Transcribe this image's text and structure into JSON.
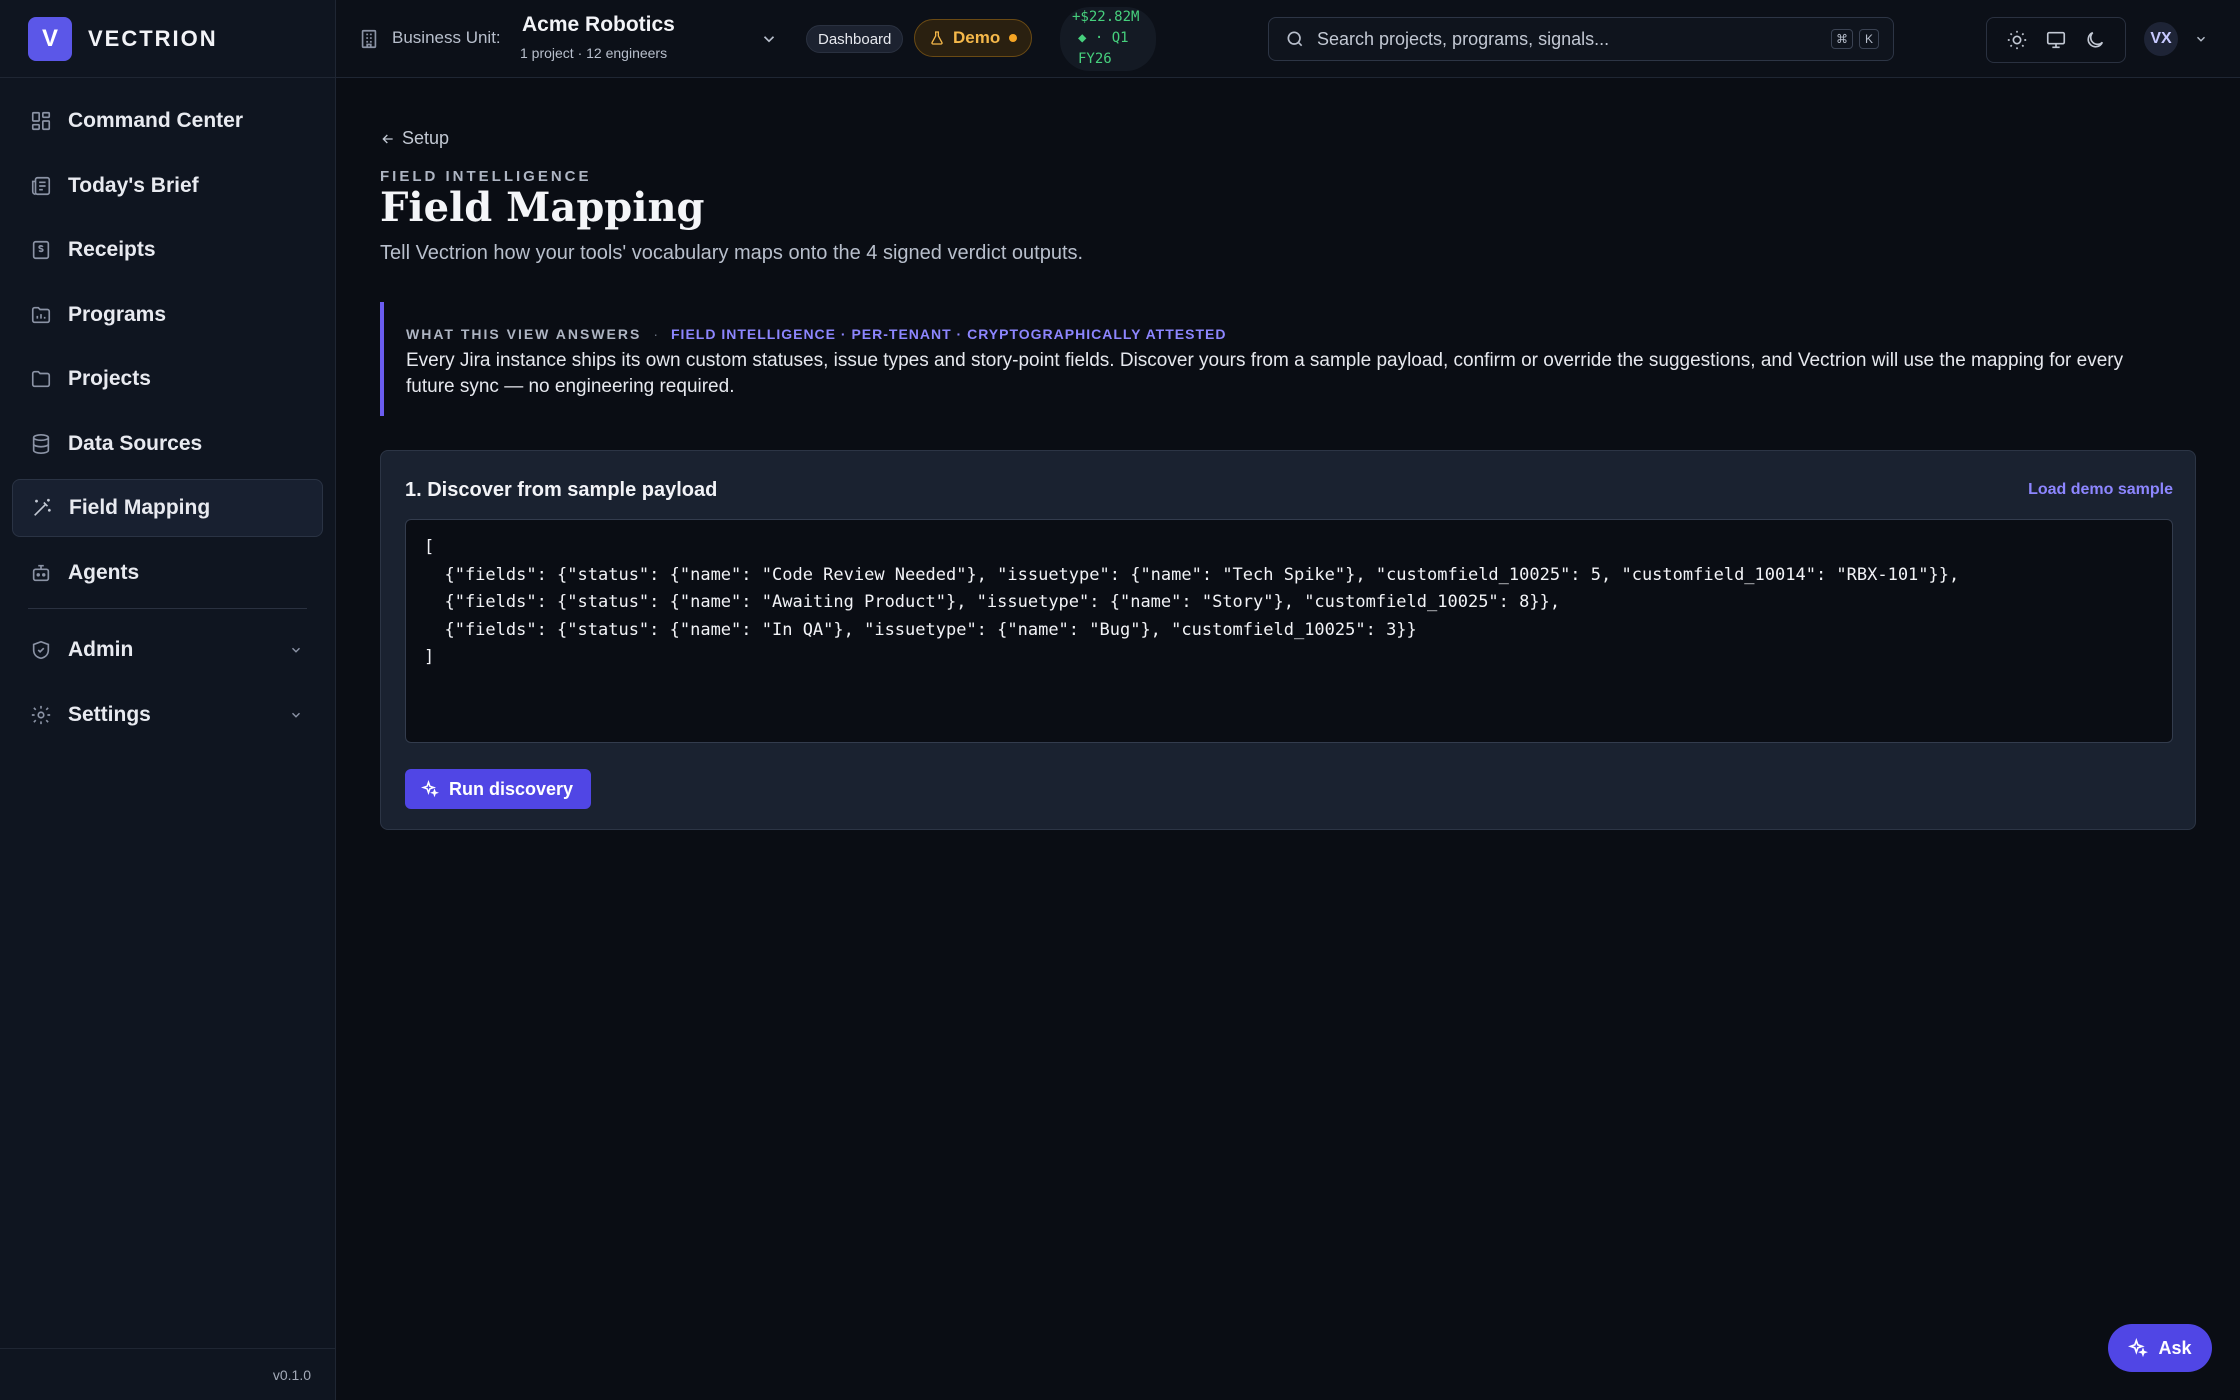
{
  "brand": {
    "logo_letter": "V",
    "name": "VECTRION"
  },
  "sidebar": {
    "items": [
      {
        "label": "Command Center",
        "icon": "grid-icon"
      },
      {
        "label": "Today's Brief",
        "icon": "newspaper-icon"
      },
      {
        "label": "Receipts",
        "icon": "receipt-icon"
      },
      {
        "label": "Programs",
        "icon": "chart-folder-icon"
      },
      {
        "label": "Projects",
        "icon": "folder-icon"
      },
      {
        "label": "Data Sources",
        "icon": "database-icon"
      },
      {
        "label": "Field Mapping",
        "icon": "wand-icon",
        "active": true
      },
      {
        "label": "Agents",
        "icon": "bot-icon"
      }
    ],
    "groups": [
      {
        "label": "Admin",
        "icon": "shield-icon"
      },
      {
        "label": "Settings",
        "icon": "gear-icon"
      }
    ],
    "version": "v0.1.0"
  },
  "topbar": {
    "bu_label": "Business Unit:",
    "bu_name": "Acme Robotics",
    "bu_sub": "1 project · 12 engineers",
    "dashboard_pill": "Dashboard",
    "demo_pill": "Demo",
    "ticker": {
      "line1": "+$22.82M",
      "line2": "◆ · Q1",
      "line3": "FY26"
    },
    "search_placeholder": "Search projects, programs, signals...",
    "shortcut_keys": [
      "⌘",
      "K"
    ],
    "avatar": "VX"
  },
  "page": {
    "back_label": "Setup",
    "eyebrow": "FIELD INTELLIGENCE",
    "title": "Field Mapping",
    "subtitle": "Tell Vectrion how your tools' vocabulary maps onto the 4 signed verdict outputs.",
    "callout": {
      "label": "WHAT THIS VIEW ANSWERS",
      "tags": "FIELD INTELLIGENCE · PER-TENANT · CRYPTOGRAPHICALLY ATTESTED",
      "body": "Every Jira instance ships its own custom statuses, issue types and story-point fields. Discover yours from a sample payload, confirm or override the suggestions, and Vectrion will use the mapping for every future sync — no engineering required."
    },
    "discover": {
      "title": "1. Discover from sample payload",
      "load_demo": "Load demo sample",
      "payload": "[\n  {\"fields\": {\"status\": {\"name\": \"Code Review Needed\"}, \"issuetype\": {\"name\": \"Tech Spike\"}, \"customfield_10025\": 5, \"customfield_10014\": \"RBX-101\"}},\n  {\"fields\": {\"status\": {\"name\": \"Awaiting Product\"}, \"issuetype\": {\"name\": \"Story\"}, \"customfield_10025\": 8}},\n  {\"fields\": {\"status\": {\"name\": \"In QA\"}, \"issuetype\": {\"name\": \"Bug\"}, \"customfield_10025\": 3}}\n]",
      "run_label": "Run discovery"
    }
  },
  "ask_label": "Ask",
  "colors": {
    "accent": "#5046e5",
    "accent_text": "#8d86ff",
    "demo": "#f5a524",
    "ticker": "#46d07d"
  }
}
